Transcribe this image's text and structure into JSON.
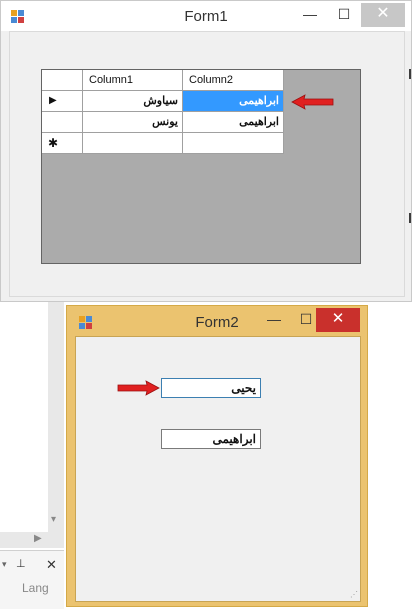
{
  "form1": {
    "title": "Form1",
    "minimize_glyph": "—",
    "maximize_glyph": "☐",
    "close_glyph": "✕",
    "grid": {
      "columns": [
        "Column1",
        "Column2"
      ],
      "rows": [
        {
          "indicator": "▶",
          "cells": [
            "سیاوش",
            "ابراهیمی"
          ],
          "selected_cell": 1
        },
        {
          "indicator": "",
          "cells": [
            "یونس",
            "ابراهیمی"
          ]
        }
      ],
      "new_row_indicator": "✱"
    }
  },
  "form2": {
    "title": "Form2",
    "minimize_glyph": "—",
    "maximize_glyph": "☐",
    "close_glyph": "✕",
    "textbox1_value": "یحیی",
    "textbox2_value": "ابراهیمی"
  },
  "ide": {
    "toolbar_text": "Lang",
    "pin_glyph": "📌",
    "close_glyph": "✕",
    "dropdown_glyph": "▾"
  },
  "colors": {
    "selection": "#3399ff",
    "arrow": "#e02020",
    "form2_border": "#ebc36f",
    "form2_close": "#c9302c"
  }
}
